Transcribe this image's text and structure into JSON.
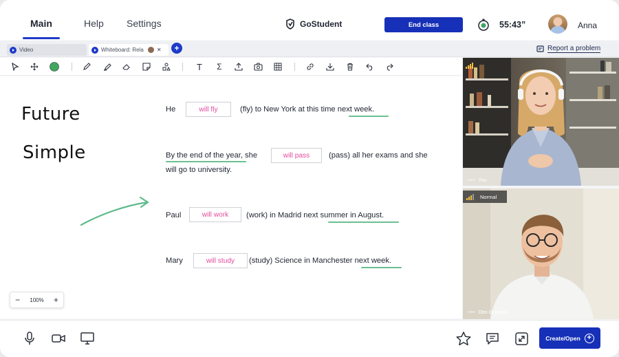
{
  "nav": {
    "tabs": [
      {
        "label": "Main"
      },
      {
        "label": "Help"
      },
      {
        "label": "Settings"
      }
    ],
    "brand": "GoStudent",
    "end_class": "End class",
    "timer": "55:43”",
    "user_name": "Anna"
  },
  "tabs": {
    "video": "Video",
    "whiteboard": "Whiteboard: Rela",
    "report": "Report a problem"
  },
  "toolbar": {
    "icons": [
      "cursor-icon",
      "move-icon",
      "color-picker-icon",
      "pen-icon",
      "highlighter-icon",
      "eraser-icon",
      "sticky-note-icon",
      "shapes-icon",
      "text-icon",
      "formula-icon",
      "upload-icon",
      "camera-icon",
      "grid-icon",
      "link-icon",
      "download-icon",
      "delete-icon",
      "undo-icon",
      "redo-icon"
    ],
    "text_tool": "T",
    "formula_tool": "Σ",
    "active_color": "#3fa75f"
  },
  "board": {
    "heading_line1": "Future",
    "heading_line2": "Simple",
    "s1": {
      "before": "He",
      "answer": "will fly",
      "after": "(fly) to New York at this time next week."
    },
    "s2": {
      "before": "By the end of the year, she",
      "answer": "will pass",
      "after": "(pass) all her exams and she",
      "line2": "will go to university."
    },
    "s3": {
      "before": "Paul",
      "answer": "will work",
      "after": "(work) in Madrid next summer in August."
    },
    "s4": {
      "before": "Mary",
      "answer": "will study",
      "after": "(study) Science in Manchester next week."
    },
    "zoom": {
      "minus": "−",
      "value": "100%",
      "plus": "+"
    },
    "answer_color": "#e44b9e",
    "underline_color": "#6bbf8f"
  },
  "videos": {
    "top_label": "You",
    "badge": "Normal",
    "bottom_label": "Otto Octavius"
  },
  "bottom": {
    "icons": [
      "microphone-icon",
      "camera-icon",
      "screen-share-icon",
      "star-icon",
      "chat-icon",
      "fullscreen-icon"
    ],
    "create_label": "Create/Open",
    "create_plus": "+"
  },
  "colors": {
    "accent": "#1730b8",
    "tab_blue": "#1e3bc8"
  }
}
